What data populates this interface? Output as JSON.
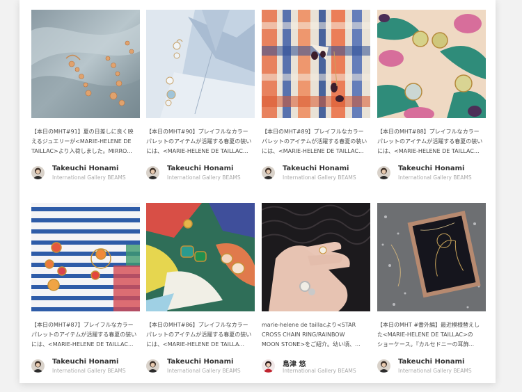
{
  "posts": [
    {
      "lines": [
        "【本日のMHT#91】夏の日差しに良く映",
        "えるジュエリーが<MARIE-HELENE DE",
        "TAILLAC>より入荷しました。MIRRO..."
      ],
      "author": "Takeuchi Honami",
      "shop": "International Gallery BEAMS"
    },
    {
      "lines": [
        "【本日のMHT#90】プレイフルなカラー",
        "パレットのアイテムが活躍する春夏の装い",
        "には、<MARIE-HELENE DE TAILLAC..."
      ],
      "author": "Takeuchi Honami",
      "shop": "International Gallery BEAMS"
    },
    {
      "lines": [
        "【本日のMHT#89】プレイフルなカラー",
        "パレットのアイテムが活躍する春夏の装い",
        "には、<MARIE-HELENE DE TAILLAC..."
      ],
      "author": "Takeuchi Honami",
      "shop": "International Gallery BEAMS"
    },
    {
      "lines": [
        "【本日のMHT#88】プレイフルなカラー",
        "パレットのアイテムが活躍する春夏の装い",
        "には、<MARIE-HELENE DE TAILLAC..."
      ],
      "author": "Takeuchi Honami",
      "shop": "International Gallery BEAMS"
    },
    {
      "lines": [
        "【本日のMHT#87】プレイフルなカラー",
        "パレットのアイテムが活躍する春夏の装い",
        "には、<MARIE-HELENE DE TAILLAC..."
      ],
      "author": "Takeuchi Honami",
      "shop": "International Gallery BEAMS"
    },
    {
      "lines": [
        "【本日のMHT#86】プレイフルなカラー",
        "パレットのアイテムが活躍する春夏の装い",
        "には、<MARIE-HELENE DE TAILLA..."
      ],
      "author": "Takeuchi Honami",
      "shop": "International Gallery BEAMS"
    },
    {
      "lines": [
        "marie-helene de taillacより<STAR",
        "CROSS CHAIN RING/RAINBOW",
        "MOON STONE>をご紹介。幼い頃、..."
      ],
      "author": "島津 悠",
      "shop": "International Gallery BEAMS"
    },
    {
      "lines": [
        "【本日のMHT #番外編】最近模様替えし",
        "た<MARIE-HELENE DE TAILLAC>の",
        "ショーケース。『カルセドニーの耳飾..."
      ],
      "author": "Takeuchi Honami",
      "shop": "International Gallery BEAMS"
    }
  ]
}
